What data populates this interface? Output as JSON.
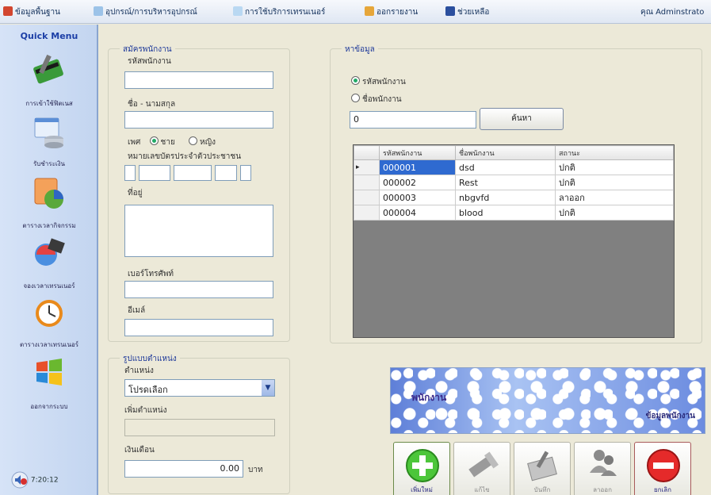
{
  "menubar": {
    "items": [
      {
        "label": "ข้อมูลพื้นฐาน",
        "icon": "database-icon"
      },
      {
        "label": "อุปกรณ์/การบริหารอุปกรณ์",
        "icon": "device-icon"
      },
      {
        "label": "การใช้บริการเทรนเนอร์",
        "icon": "trainer-icon"
      },
      {
        "label": "ออกรายงาน",
        "icon": "report-icon"
      },
      {
        "label": "ช่วยเหลือ",
        "icon": "help-icon"
      }
    ],
    "user": "คุณ Adminstrato"
  },
  "sidebar": {
    "title": "Quick Menu",
    "items": [
      {
        "label": "การเข้าใช้ฟิตเนส",
        "icon": "card-icon"
      },
      {
        "label": "รับชำระเงิน",
        "icon": "payment-icon"
      },
      {
        "label": "ตารางเวลากิจกรรม",
        "icon": "schedule-icon"
      },
      {
        "label": "จองเวลาเทรนเนอร์",
        "icon": "booking-icon"
      },
      {
        "label": "ตารางเวลาเทรนเนอร์",
        "icon": "clock-icon"
      },
      {
        "label": "ออกจากระบบ",
        "icon": "windows-logo-icon"
      }
    ],
    "time": "7:20:12"
  },
  "employee_form": {
    "legend": "สมัครพนักงาน",
    "emp_id_label": "รหัสพนักงาน",
    "emp_id_value": "",
    "name_label": "ชื่อ - นามสกุล",
    "name_value": "",
    "gender_label": "เพศ",
    "gender_male": "ชาย",
    "gender_female": "หญิง",
    "gender_selected": "male",
    "id_card_label": "หมายเลขบัตรประจำตัวประชาชน",
    "address_label": "ที่อยู่",
    "phone_label": "เบอร์โทรศัพท์",
    "email_label": "อีเมล์"
  },
  "position_form": {
    "legend": "รูปแบบตำแหน่ง",
    "position_label": "ตำแหน่ง",
    "position_selected": "โปรดเลือก",
    "add_position_label": "เพิ่มตำแหน่ง",
    "salary_label": "เงินเดือน",
    "salary_value": "0.00",
    "salary_unit": "บาท"
  },
  "search": {
    "legend": "หาข้อมูล",
    "by_id": "รหัสพนักงาน",
    "by_name": "ชื่อพนักงาน",
    "selected": "id",
    "query": "0",
    "button": "ค้นหา"
  },
  "grid": {
    "columns": [
      "รหัสพนักงาน",
      "ชื่อพนักงาน",
      "สถานะ"
    ],
    "rows": [
      {
        "id": "000001",
        "name": "dsd",
        "status": "ปกติ",
        "selected": true
      },
      {
        "id": "000002",
        "name": "Rest",
        "status": "ปกติ",
        "selected": false
      },
      {
        "id": "000003",
        "name": "nbgvfd",
        "status": "ลาออก",
        "selected": false
      },
      {
        "id": "000004",
        "name": "blood",
        "status": "ปกติ",
        "selected": false
      }
    ]
  },
  "banner": {
    "title": "พนักงาน",
    "subtitle": "ข้อมูลพนักงาน"
  },
  "toolbar": {
    "add": "เพิ่มใหม่",
    "edit": "แก้ไข",
    "save": "บันทึก",
    "resign": "ลาออก",
    "cancel": "ยกเลิก"
  }
}
